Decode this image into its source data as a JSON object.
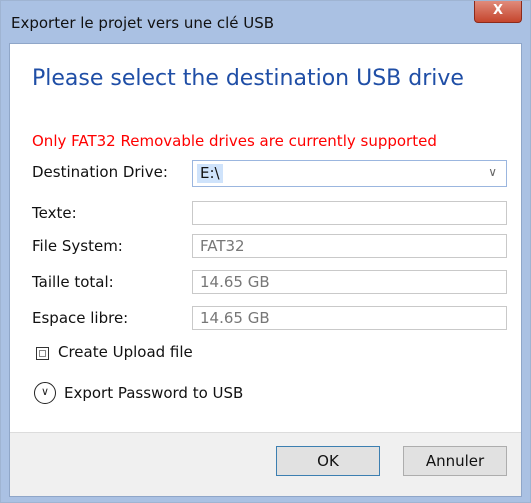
{
  "window": {
    "title": "Exporter le projet vers une clé USB",
    "close_label": "X"
  },
  "dialog": {
    "heading": "Please select the destination USB drive",
    "warning": "Only FAT32 Removable drives are currently supported",
    "fields": {
      "destination_label": "Destination Drive:",
      "destination_value": "E:\\",
      "texte_label": "Texte:",
      "texte_value": "",
      "filesystem_label": "File System:",
      "filesystem_value": "FAT32",
      "total_label": "Taille total:",
      "total_value": "14.65 GB",
      "free_label": "Espace libre:",
      "free_value": "14.65 GB"
    },
    "create_upload_label": "Create Upload file",
    "create_upload_checked": false,
    "export_password_label": "Export Password to USB"
  },
  "buttons": {
    "ok": "OK",
    "cancel": "Annuler"
  },
  "colors": {
    "heading": "#1f4ea6",
    "warning": "#ff0000",
    "titlebar": "#aac1e3"
  }
}
